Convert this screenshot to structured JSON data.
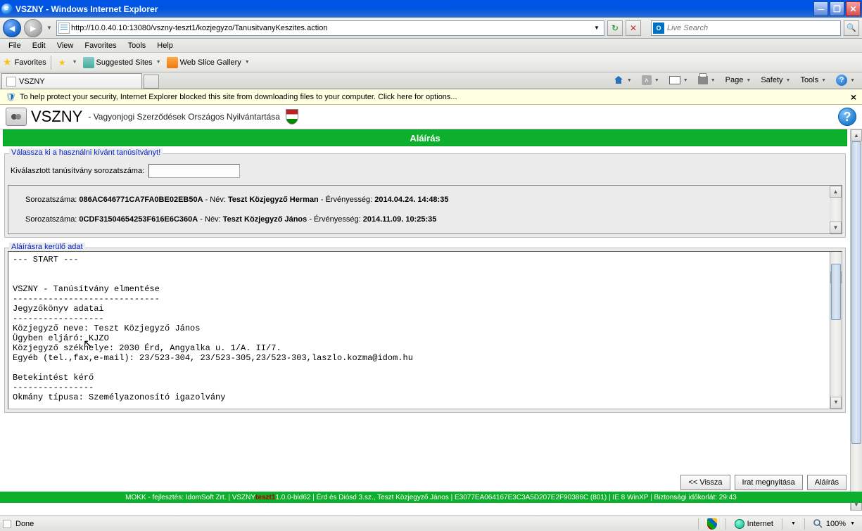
{
  "titlebar": {
    "title": "VSZNY - Windows Internet Explorer"
  },
  "nav": {
    "url": "http://10.0.40.10:13080/vszny-teszt1/kozjegyzo/TanusitvanyKeszites.action",
    "search_placeholder": "Live Search"
  },
  "menu": {
    "file": "File",
    "edit": "Edit",
    "view": "View",
    "favorites": "Favorites",
    "tools": "Tools",
    "help": "Help"
  },
  "favbar": {
    "favorites": "Favorites",
    "suggested": "Suggested Sites",
    "webslice": "Web Slice Gallery"
  },
  "tabs": {
    "active": "VSZNY"
  },
  "tabtools": {
    "page": "Page",
    "safety": "Safety",
    "tools": "Tools"
  },
  "infobar": {
    "text": "To help protect your security, Internet Explorer blocked this site from downloading files to your computer. Click here for options..."
  },
  "app": {
    "title": "VSZNY",
    "subtitle": "- Vagyonjogi Szerződések Országos Nyilvántartása",
    "sectiontitle": "Aláírás",
    "fs1_legend": "Válassza ki a használni kívánt tanúsítványt!",
    "field_label": "Kiválasztott tanúsítvány sorozatszáma:",
    "cert_prefix": "Sorozatszáma: ",
    "cert_name": " - Név: ",
    "cert_valid": " - Érvényesség: ",
    "certs": [
      {
        "serial": "086AC646771CA7FA0BE02EB50A",
        "name": "Teszt Közjegyző Herman",
        "validity": "2014.04.24. 14:48:35"
      },
      {
        "serial": "0CDF31504654253F616E6C360A",
        "name": "Teszt Közjegyző János",
        "validity": "2014.11.09. 10:25:35"
      }
    ],
    "fs2_legend": "Aláírásra kerülő adat",
    "signtext": "--- START ---\n\n\nVSZNY - Tanúsítvány elmentése\n-----------------------------\nJegyzőkönyv adatai\n------------------\nKözjegyző neve: Teszt Közjegyző János\nÜgyben eljáró: KJZO\nKözjegyző székhelye: 2030 Érd, Angyalka u. 1/A. II/7.\nEgyéb (tel.,fax,e-mail): 23/523-304, 23/523-305,23/523-303,laszlo.kozma@idom.hu\n\nBetekintést kérő\n----------------\nOkmány típusa: Személyazonosító igazolvány",
    "buttons": {
      "back": "<< Vissza",
      "open": "Irat megnyitása",
      "sign": "Aláírás"
    },
    "footer_left": "MOKK - fejlesztés: IdomSoft Zrt.  |  VSZNY ",
    "footer_env": "teszt1",
    "footer_mid": " 1.0.0-bld62  |  Érd és Diósd 3.sz., Teszt Közjegyző János  |  E3077EA064167E3C3A5D207E2F90386C (801)  |  IE 8 WinXP  |  Biztonsági időkorlát:  29:43"
  },
  "status": {
    "done": "Done",
    "internet": "Internet",
    "zoom": "100%"
  }
}
